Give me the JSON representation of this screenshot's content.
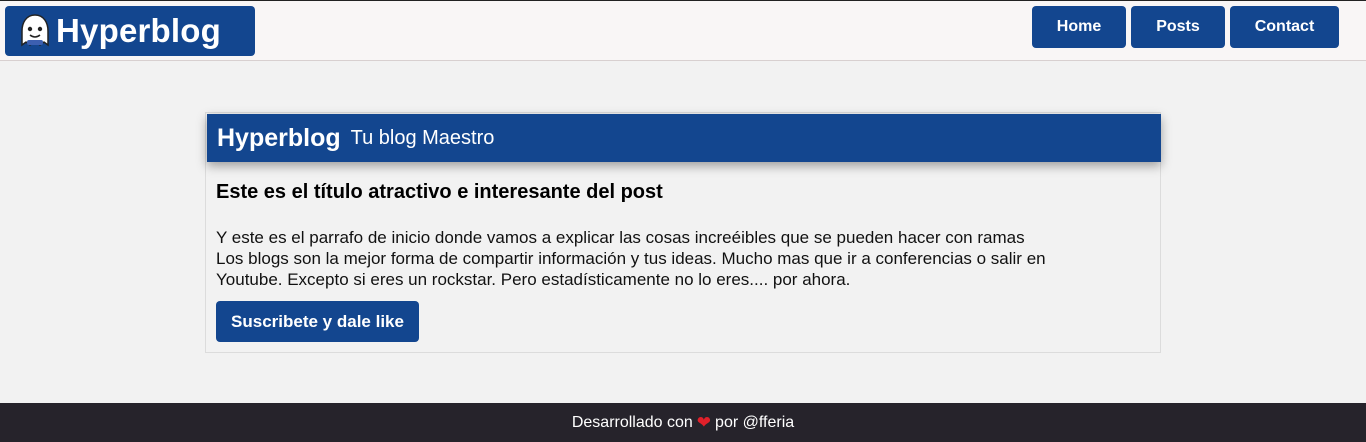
{
  "header": {
    "brand_name": "Hyperblog",
    "logo_icon": "ghost-logo-icon",
    "nav": [
      {
        "label": "Home"
      },
      {
        "label": "Posts"
      },
      {
        "label": "Contact"
      }
    ]
  },
  "card": {
    "header_title": "Hyperblog",
    "header_subtitle": "Tu blog Maestro",
    "post_title": "Este es el título atractivo e interesante del post",
    "post_line1": "Y este es el parrafo de inicio donde vamos a explicar las cosas increéibles que se pueden hacer con ramas",
    "post_line2": "Los blogs son la mejor forma de compartir información y tus ideas. Mucho mas que ir a conferencias o salir en Youtube. Excepto si eres un rockstar. Pero estadísticamente no lo eres.... por ahora.",
    "cta_label": "Suscribete y dale like"
  },
  "footer": {
    "prefix": "Desarrollado con",
    "heart_glyph": "❤",
    "suffix": "por @fferia"
  },
  "colors": {
    "brand_blue": "#13468f",
    "footer_bg": "#26232b",
    "heart": "#e0202a"
  }
}
